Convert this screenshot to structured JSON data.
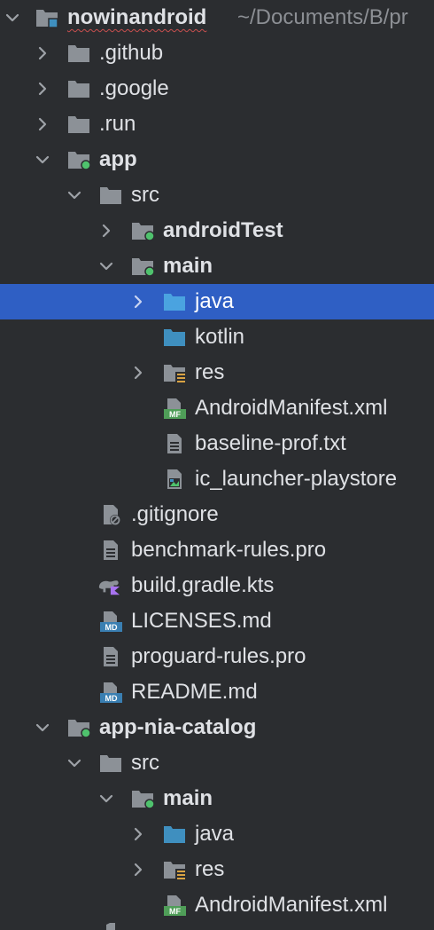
{
  "project": {
    "root_name": "nowinandroid",
    "root_path": "~/Documents/B/pr"
  },
  "nodes": {
    "github": ".github",
    "google": ".google",
    "run": ".run",
    "app": "app",
    "app_src": "src",
    "app_android_test": "androidTest",
    "app_main": "main",
    "app_java": "java",
    "app_kotlin": "kotlin",
    "app_res": "res",
    "app_manifest": "AndroidManifest.xml",
    "app_baseline": "baseline-prof.txt",
    "app_launcher": "ic_launcher-playstore",
    "app_gitignore": ".gitignore",
    "app_benchmark_rules": "benchmark-rules.pro",
    "app_build_gradle": "build.gradle.kts",
    "app_licenses": "LICENSES.md",
    "app_proguard": "proguard-rules.pro",
    "app_readme": "README.md",
    "catalog": "app-nia-catalog",
    "catalog_src": "src",
    "catalog_main": "main",
    "catalog_java": "java",
    "catalog_res": "res",
    "catalog_manifest": "AndroidManifest.xml"
  },
  "badges": {
    "manifest": "MF",
    "markdown": "MD"
  },
  "colors": {
    "background": "#2b2d30",
    "selection": "#2f5fc4",
    "folder": "#8c9197",
    "source_folder": "#3f8fbf",
    "module_dot": "#4fc26d",
    "resource_lines": "#d9a343",
    "manifest_badge": "#4f9e58",
    "markdown_badge": "#3a7fb2",
    "kotlin_gradient": "#a873f0"
  },
  "selected_node": "java"
}
